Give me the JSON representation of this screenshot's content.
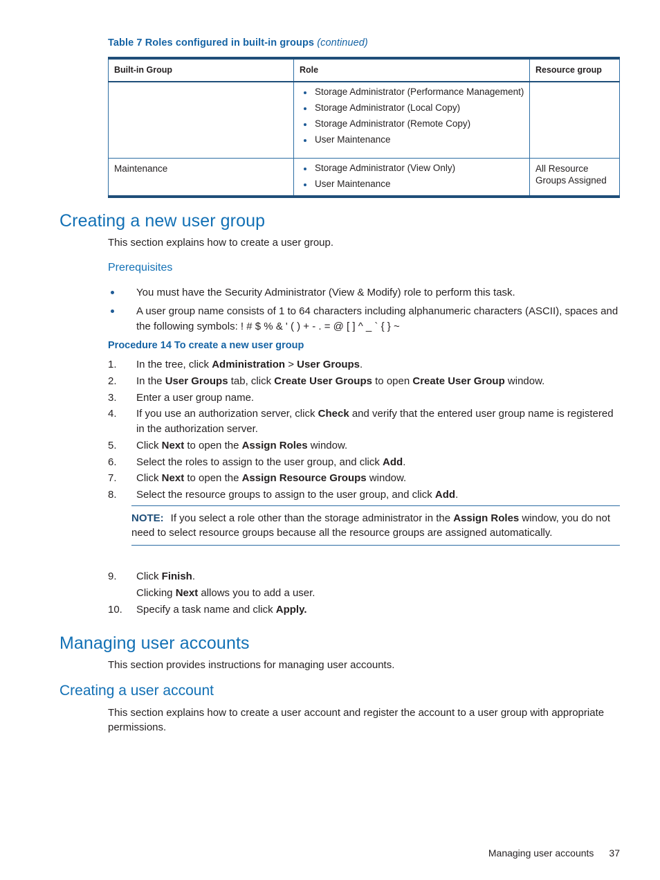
{
  "table": {
    "caption_main": "Table 7 Roles configured in built-in groups",
    "caption_continued": "(continued)",
    "headers": [
      "Built-in Group",
      "Role",
      "Resource group"
    ],
    "rows": [
      {
        "group": "",
        "roles": [
          "Storage Administrator (Performance Management)",
          "Storage Administrator (Local Copy)",
          "Storage Administrator (Remote Copy)",
          "User Maintenance"
        ],
        "resource_group": ""
      },
      {
        "group": "Maintenance",
        "roles": [
          "Storage Administrator (View Only)",
          "User Maintenance"
        ],
        "resource_group": "All Resource Groups Assigned"
      }
    ]
  },
  "section_user_group": {
    "heading": "Creating a new user group",
    "intro": "This section explains how to create a user group.",
    "prereq_heading": "Prerequisites",
    "prereq_items": [
      "You must have the Security Administrator (View & Modify) role to perform this task.",
      "A user group name consists of 1 to 64 characters including alphanumeric characters (ASCII), spaces and the following symbols: ! # $ % & ' ( ) + - . = @ [ ] ^ _ ` { } ~"
    ],
    "procedure_heading": "Procedure 14 To create a new user group",
    "steps": [
      {
        "num": "1.",
        "text": "In the tree, click Administration > User Groups."
      },
      {
        "num": "2.",
        "text": "In the User Groups tab, click Create User Groups to open Create User Group window."
      },
      {
        "num": "3.",
        "text": "Enter a user group name."
      },
      {
        "num": "4.",
        "text": "If you use an authorization server, click Check and verify that the entered user group name is registered in the authorization server."
      },
      {
        "num": "5.",
        "text": "Click Next to open the Assign Roles window."
      },
      {
        "num": "6.",
        "text": "Select the roles to assign to the user group, and click Add."
      },
      {
        "num": "7.",
        "text": "Click Next to open the Assign Resource Groups window."
      },
      {
        "num": "8.",
        "text": "Select the resource groups to assign to the user group, and click Add."
      },
      {
        "num": "9.",
        "text": "Click Finish."
      },
      {
        "num": "10.",
        "text": "Specify a task name and click Apply."
      }
    ],
    "step9_subtext": "Clicking Next allows you to add a user.",
    "note_label": "NOTE:",
    "note_text": "If you select a role other than the storage administrator in the Assign Roles window, you do not need to select resource groups because all the resource groups are assigned automatically."
  },
  "section_user_accounts": {
    "heading": "Managing user accounts",
    "intro": "This section provides instructions for managing user accounts.",
    "sub_heading": "Creating a user account",
    "sub_intro": "This section explains how to create a user account and register the account to a user group with appropriate permissions."
  },
  "footer": {
    "text": "Managing user accounts",
    "page": "37"
  },
  "colors": {
    "heading_blue": "#1270b5",
    "caption_blue": "#1563a4",
    "table_border_dark": "#1f4e79",
    "table_border_light": "#2b6ca3",
    "bullet_blue": "#1f5b96",
    "body_text": "#231f20"
  }
}
